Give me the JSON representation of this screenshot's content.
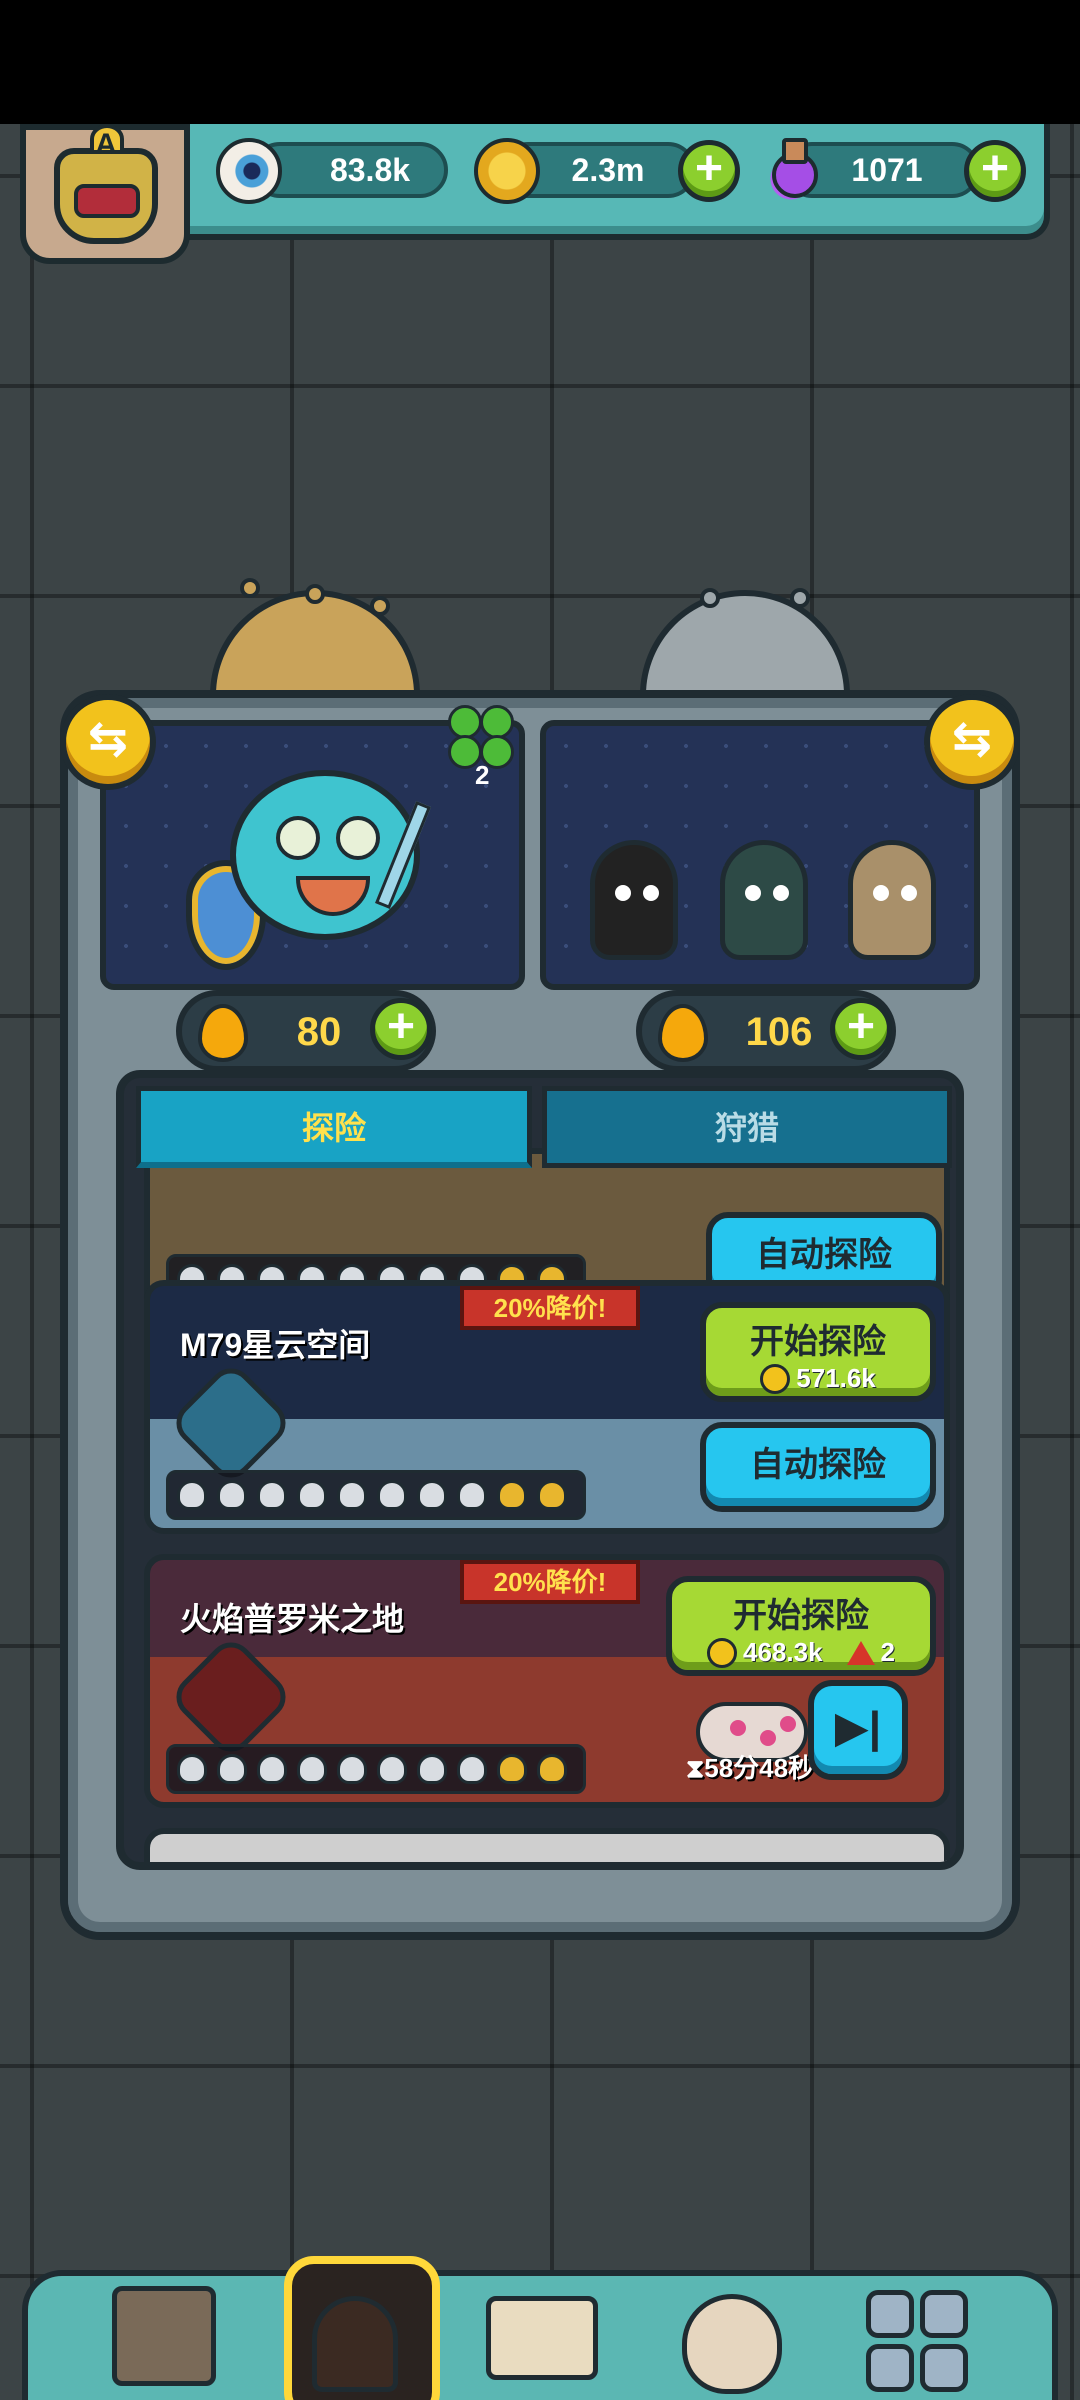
{
  "resources": {
    "eyes": {
      "icon": "eyeball-icon",
      "value": "83.8k"
    },
    "coins": {
      "icon": "gold-coin-icon",
      "value": "2.3m"
    },
    "potions": {
      "icon": "purple-potion-icon",
      "value": "1071"
    }
  },
  "profile": {
    "rank_letter": "A"
  },
  "team": {
    "hero_clover_count": "2",
    "left_energy": "80",
    "right_energy": "106"
  },
  "tabs": {
    "explore": "探险",
    "hunt": "狩猎"
  },
  "levels": [
    {
      "title": "",
      "auto_label": "自动探险"
    },
    {
      "title": "M79星云空间",
      "discount": "20%降价!",
      "start_label": "开始探险",
      "start_cost": "571.6k",
      "auto_label": "自动探险"
    },
    {
      "title": "火焰普罗米之地",
      "discount": "20%降价!",
      "start_label": "开始探险",
      "start_cost": "468.3k",
      "ticket_cost": "2",
      "timer": "58分48秒"
    }
  ],
  "colors": {
    "accent_green": "#a6d934",
    "accent_blue": "#26c6ef",
    "gold": "#f2c21c",
    "panel_teal": "#57b8b6"
  }
}
